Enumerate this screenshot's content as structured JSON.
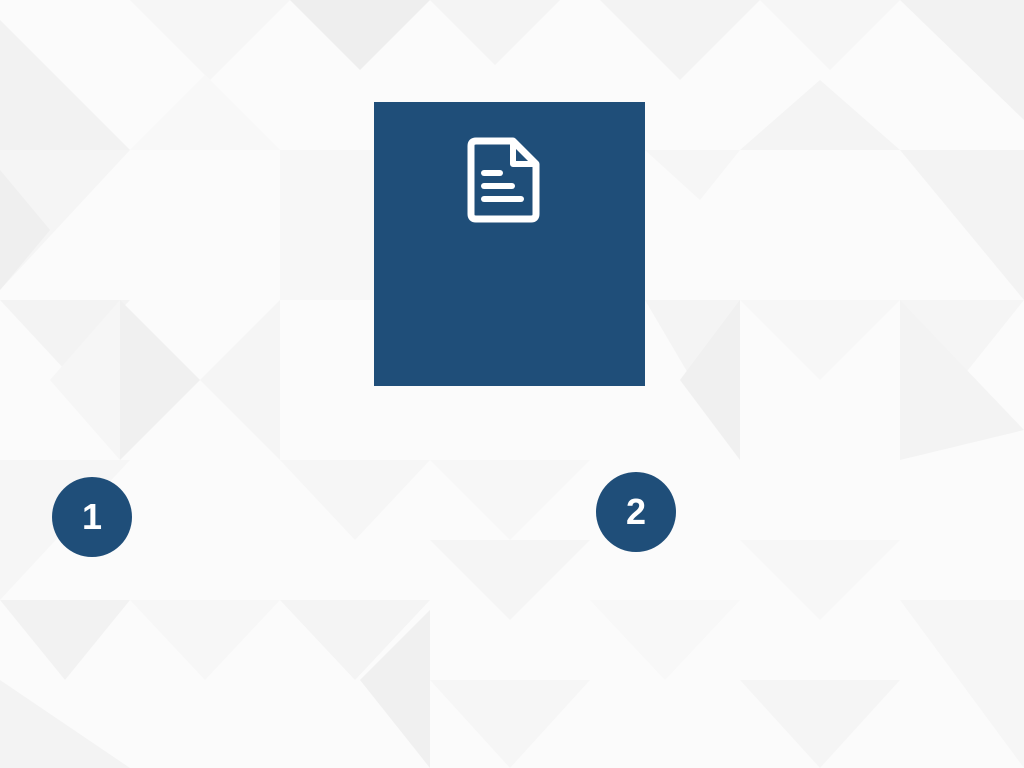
{
  "colors": {
    "accent": "#1f4e79",
    "icon": "#ffffff",
    "background": "#fbfbfb"
  },
  "document_card": {
    "icon": "document-icon"
  },
  "steps": [
    {
      "label": "1"
    },
    {
      "label": "2"
    }
  ]
}
